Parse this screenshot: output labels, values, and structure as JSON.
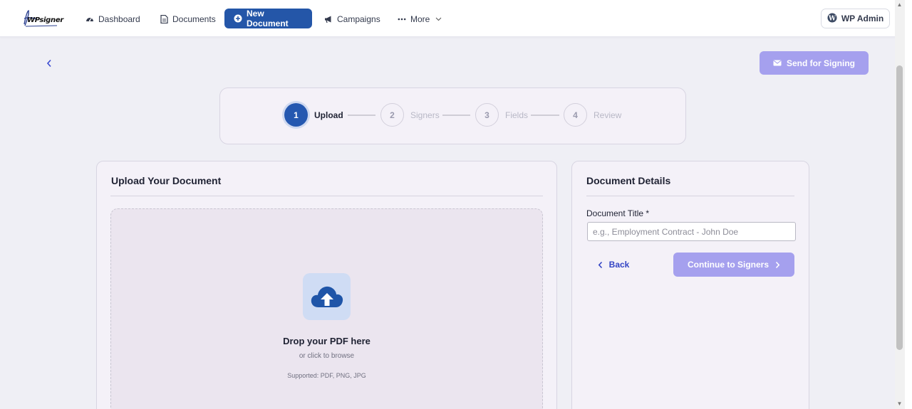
{
  "nav": {
    "logo_text": "WPsigner",
    "items": [
      {
        "label": "Dashboard",
        "icon": "gauge-icon"
      },
      {
        "label": "Documents",
        "icon": "document-icon"
      },
      {
        "label": "New Document",
        "icon": "plus-circle-icon"
      },
      {
        "label": "Campaigns",
        "icon": "megaphone-icon"
      },
      {
        "label": "More",
        "icon": "dots-icon"
      }
    ],
    "wp_admin": "WP Admin"
  },
  "header": {
    "send_label": "Send for Signing"
  },
  "stepper": {
    "steps": [
      {
        "number": "1",
        "label": "Upload",
        "active": true
      },
      {
        "number": "2",
        "label": "Signers",
        "active": false
      },
      {
        "number": "3",
        "label": "Fields",
        "active": false
      },
      {
        "number": "4",
        "label": "Review",
        "active": false
      }
    ]
  },
  "upload": {
    "title": "Upload Your Document",
    "drop_title": "Drop your PDF here",
    "drop_sub": "or click to browse",
    "supported": "Supported: PDF, PNG, JPG"
  },
  "details": {
    "title": "Document Details",
    "field_label": "Document Title *",
    "placeholder": "e.g., Employment Contract - John Doe",
    "back_label": "Back",
    "continue_label": "Continue to Signers"
  },
  "colors": {
    "primary": "#2456a8",
    "accent_disabled": "#a5a0ee",
    "link": "#3344c4"
  }
}
